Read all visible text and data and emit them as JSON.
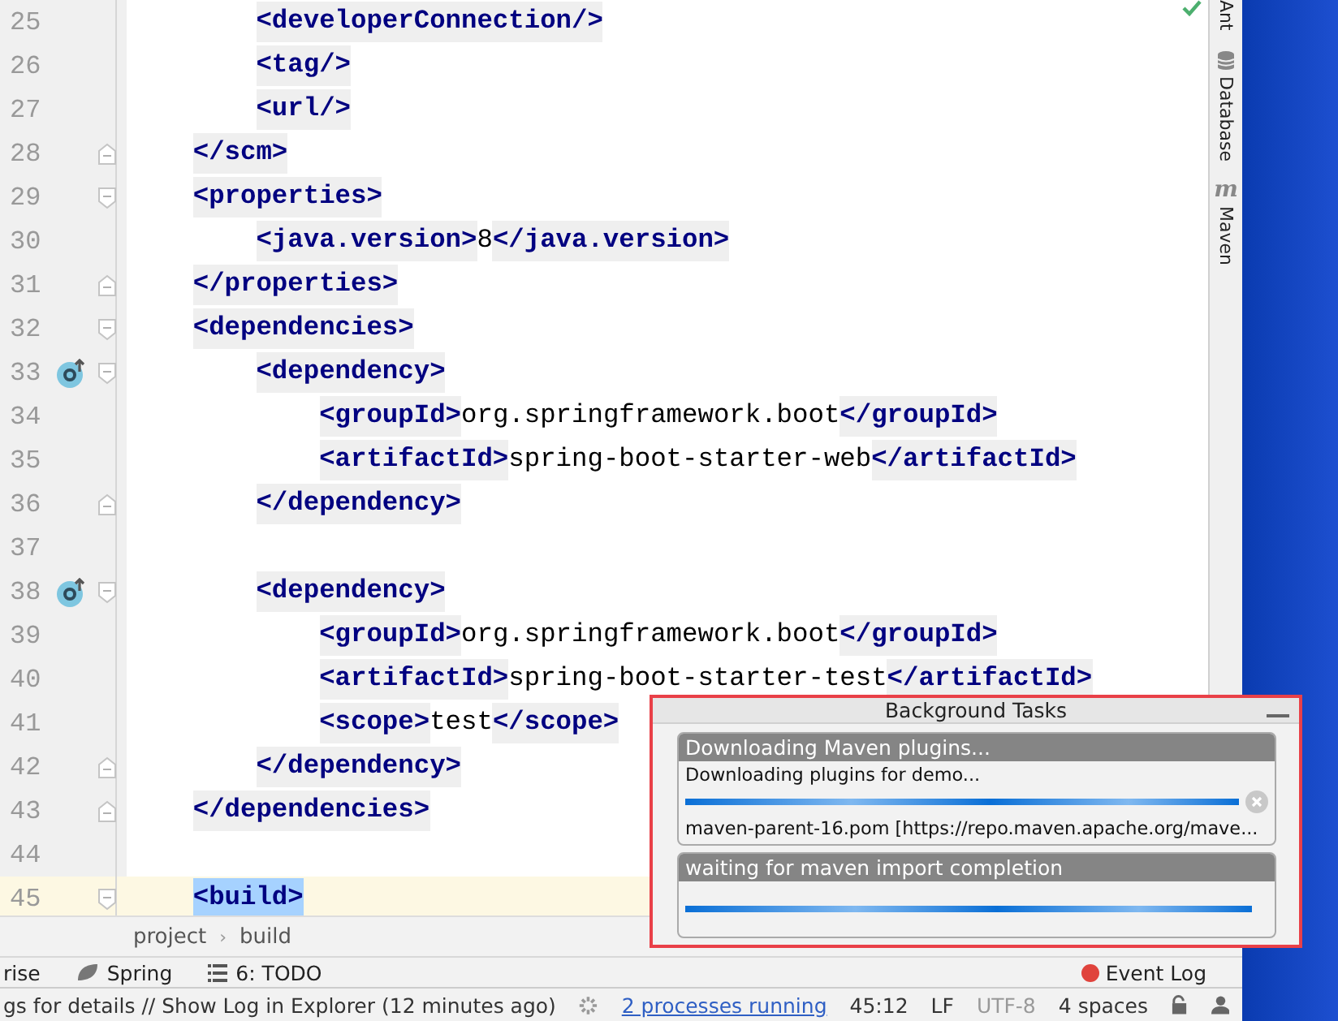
{
  "editor": {
    "lines": [
      {
        "number": "25",
        "code": "        <developerConnection/>",
        "fold_open": false,
        "fold_close": false,
        "marker": false,
        "current": false,
        "selected": false
      },
      {
        "number": "26",
        "code": "        <tag/>",
        "fold_open": false,
        "fold_close": false,
        "marker": false,
        "current": false,
        "selected": false
      },
      {
        "number": "27",
        "code": "        <url/>",
        "fold_open": false,
        "fold_close": false,
        "marker": false,
        "current": false,
        "selected": false
      },
      {
        "number": "28",
        "code": "    </scm>",
        "fold_open": false,
        "fold_close": true,
        "marker": false,
        "current": false,
        "selected": false
      },
      {
        "number": "29",
        "code": "    <properties>",
        "fold_open": true,
        "fold_close": false,
        "marker": false,
        "current": false,
        "selected": false
      },
      {
        "number": "30",
        "code": "        <java.version>8</java.version>",
        "fold_open": false,
        "fold_close": false,
        "marker": false,
        "current": false,
        "selected": false
      },
      {
        "number": "31",
        "code": "    </properties>",
        "fold_open": false,
        "fold_close": true,
        "marker": false,
        "current": false,
        "selected": false
      },
      {
        "number": "32",
        "code": "    <dependencies>",
        "fold_open": true,
        "fold_close": false,
        "marker": false,
        "current": false,
        "selected": false
      },
      {
        "number": "33",
        "code": "        <dependency>",
        "fold_open": true,
        "fold_close": false,
        "marker": true,
        "current": false,
        "selected": false
      },
      {
        "number": "34",
        "code": "            <groupId>org.springframework.boot</groupId>",
        "fold_open": false,
        "fold_close": false,
        "marker": false,
        "current": false,
        "selected": false
      },
      {
        "number": "35",
        "code": "            <artifactId>spring-boot-starter-web</artifactId>",
        "fold_open": false,
        "fold_close": false,
        "marker": false,
        "current": false,
        "selected": false
      },
      {
        "number": "36",
        "code": "        </dependency>",
        "fold_open": false,
        "fold_close": true,
        "marker": false,
        "current": false,
        "selected": false
      },
      {
        "number": "37",
        "fold_open": false,
        "fold_close": false,
        "marker": false,
        "current": false,
        "selected": false
      },
      {
        "number": "38",
        "code": "        <dependency>",
        "fold_open": true,
        "fold_close": false,
        "marker": true,
        "current": false,
        "selected": false
      },
      {
        "number": "39",
        "code": "            <groupId>org.springframework.boot</groupId>",
        "fold_open": false,
        "fold_close": false,
        "marker": false,
        "current": false,
        "selected": false
      },
      {
        "number": "40",
        "code": "            <artifactId>spring-boot-starter-test</artifactId>",
        "fold_open": false,
        "fold_close": false,
        "marker": false,
        "current": false,
        "selected": false
      },
      {
        "number": "41",
        "code": "            <scope>test</scope>",
        "fold_open": false,
        "fold_close": false,
        "marker": false,
        "current": false,
        "selected": false
      },
      {
        "number": "42",
        "code": "        </dependency>",
        "fold_open": false,
        "fold_close": true,
        "marker": false,
        "current": false,
        "selected": false
      },
      {
        "number": "43",
        "code": "    </dependencies>",
        "fold_open": false,
        "fold_close": true,
        "marker": false,
        "current": false,
        "selected": false
      },
      {
        "number": "44",
        "fold_open": false,
        "fold_close": false,
        "marker": false,
        "current": false,
        "selected": false
      },
      {
        "number": "45",
        "code": "    <build>",
        "fold_open": true,
        "fold_close": false,
        "marker": false,
        "current": true,
        "selected": true
      }
    ]
  },
  "right_toolbar": [
    {
      "kind": "ant",
      "label": "Ant"
    },
    {
      "kind": "database",
      "label": "Database"
    },
    {
      "kind": "maven",
      "icon": "m",
      "label": "Maven"
    }
  ],
  "breadcrumbs": {
    "items": [
      "project",
      "build"
    ],
    "separator": "›"
  },
  "tool_windows": [
    {
      "kind": "plain",
      "label": "rise"
    },
    {
      "kind": "spring",
      "label": "Spring"
    },
    {
      "kind": "todo",
      "label": "6: TODO"
    }
  ],
  "event_log": {
    "label": "Event Log"
  },
  "status_bar": {
    "message": "gs for details // Show Log in Explorer (12 minutes ago)",
    "processes": "2 processes running",
    "position": "45:12",
    "line_separator": "LF",
    "encoding": "UTF-8",
    "indent": "4 spaces"
  },
  "background_tasks": {
    "title": "Background Tasks",
    "tasks": [
      {
        "title": "Downloading Maven plugins...",
        "text": "Downloading plugins for demo...",
        "level": 1,
        "detail": "maven-parent-16.pom [https://repo.maven.apache.org/mave...",
        "cancellable": true
      },
      {
        "title": "waiting for maven import completion",
        "level": 1,
        "cancellable": false
      }
    ]
  }
}
